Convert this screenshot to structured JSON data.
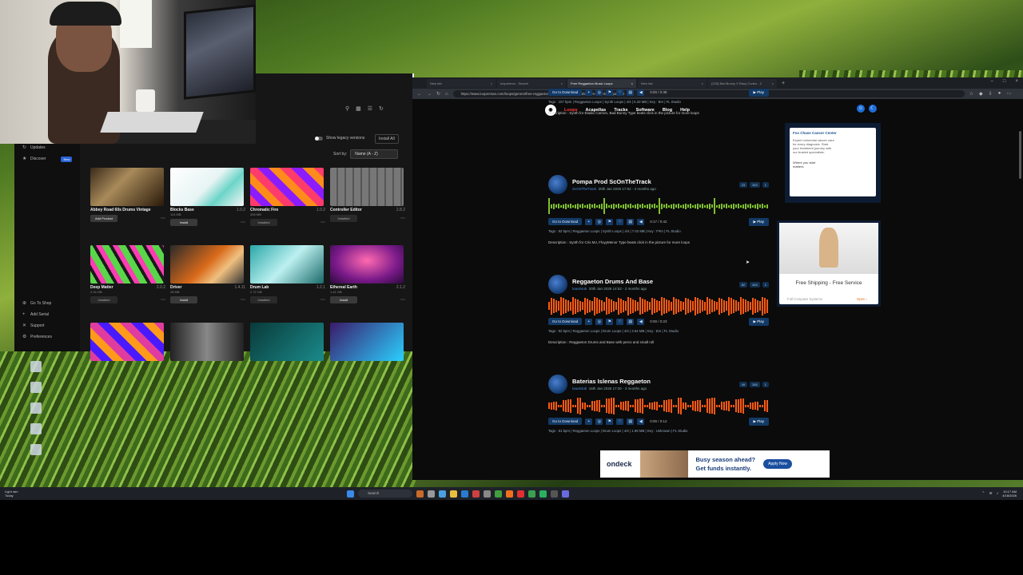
{
  "app": {
    "sidebar": {
      "items": [
        {
          "label": "Updates",
          "icon": "refresh-icon"
        },
        {
          "label": "Discover",
          "icon": "star-icon",
          "badge": "New"
        }
      ],
      "bottom_items": [
        {
          "label": "Go To Shop",
          "icon": "cart-icon"
        },
        {
          "label": "Add Serial",
          "icon": "plus-icon"
        },
        {
          "label": "Support",
          "icon": "support-icon"
        },
        {
          "label": "Preferences",
          "icon": "gear-icon"
        }
      ]
    },
    "legacy_toggle_label": "Show legacy versions",
    "install_all_label": "Install All",
    "sort_label": "Sort by:",
    "sort_value": "Name (A - Z)",
    "products": [
      {
        "name": "Abbey Road 60s Drums Vintage",
        "version": "",
        "size": "",
        "button": "Add Product",
        "thumb": "linear-gradient(135deg,#3a2a1a,#a88a5a 40%,#2a1a0a)"
      },
      {
        "name": "Blocks Base",
        "version": "1.0.2",
        "size": "114 MB",
        "button": "Install",
        "thumb": "linear-gradient(135deg,#ffffff,#e8f4f4 50%,#6cd4c8 70%,#f7f7f7)"
      },
      {
        "name": "Chromatic Fire",
        "version": "1.0.2",
        "size": "498 MB",
        "button": "Installed",
        "thumb": "repeating-linear-gradient(45deg,#ff3b6b 0 10px,#8a1cff 10px 20px,#ff8c1a 20px 30px)"
      },
      {
        "name": "Controller Editor",
        "version": "2.8.2",
        "size": "",
        "button": "Installed",
        "thumb": "repeating-linear-gradient(90deg,#777 0 8px,#555 8px 10px)"
      },
      {
        "name": "Deep Matter",
        "version": "2.0.2",
        "size": "2.04 GB",
        "button": "Installed",
        "thumb": "repeating-linear-gradient(60deg,#5ad64a 0 8px,#1a1a1a 8px 12px,#ff3cb4 12px 18px)"
      },
      {
        "name": "Driver",
        "version": "1.4.11",
        "size": "28 MB",
        "button": "Install",
        "thumb": "linear-gradient(135deg,#2a2a2a,#d96a1a 50%,#f0c080 70%,#333)"
      },
      {
        "name": "Drum Lab",
        "version": "1.2.1",
        "size": "2.72 GB",
        "button": "Installed",
        "thumb": "linear-gradient(135deg,#2aa8a8,#bdf0f0 50%,#1a6a6a)"
      },
      {
        "name": "Ethereal Earth",
        "version": "2.1.2",
        "size": "1.41 GB",
        "button": "Install",
        "thumb": "radial-gradient(ellipse at 50% 40%,#ff6ab0,#7a1a8a 60%,#2a0a3a)"
      },
      {
        "name": "",
        "version": "",
        "size": "",
        "button": "",
        "thumb": "repeating-linear-gradient(45deg,#e03ca0 0 10px,#4a1aff 10px 20px,#ff9a1a 20px 30px)"
      },
      {
        "name": "",
        "version": "",
        "size": "",
        "button": "",
        "thumb": "linear-gradient(90deg,#222,#888 50%,#222)"
      },
      {
        "name": "",
        "version": "",
        "size": "",
        "button": "",
        "thumb": "linear-gradient(135deg,#0a3a3a,#1a8a8a)"
      },
      {
        "name": "",
        "version": "",
        "size": "",
        "button": "",
        "thumb": "linear-gradient(135deg,#3a1a6a,#2ad0ff)"
      }
    ]
  },
  "browser": {
    "tabs": [
      {
        "label": "New tab"
      },
      {
        "label": "loopermon - Search"
      },
      {
        "label": "Free Reggaeton Music Loops",
        "active": true
      },
      {
        "label": "New tab"
      },
      {
        "label": "(225) Bad Bunny X Rauy Cortez - 2"
      }
    ],
    "url": "https://www.looperman.com/loops/genres/free-reggaeton-loops-samples-sounds-wavs-download?page=3",
    "site_nav": [
      "Loops",
      "Acapellas",
      "Tracks",
      "Software",
      "Blog",
      "Help"
    ],
    "loops": [
      {
        "title": "",
        "user": "",
        "date": "",
        "counts": [],
        "time": "0:00 / 0:38",
        "tags": "Tags : 107 bpm | Reggaeton Loops | Synth Loops | 4/4 | 6.33 MB | Key : Bm | FL Studio",
        "description": "Description : Synth for Eladio Carrion, Bad Bunny Type beats click in the picture for more loops",
        "wave": "none"
      },
      {
        "title": "Pompa Prod ScOnTheTrack",
        "user": "ScOnTheTrack",
        "date": "20th Jan 2026 17:52 - 2 months ago",
        "counts": [
          "23",
          "343",
          "1"
        ],
        "time": "0:17 / 0:42",
        "tags": "Tags : 92 bpm | Reggaeton Loops | Synth Loops | 4/4 | 7.02 MB | Key : F#m | FL Studio",
        "description": "Description : Synth for Cris MJ, FloyyMenor Type beats click in the picture for more loops",
        "wave": "green"
      },
      {
        "title": "Reggaeton Drums And Base",
        "user": "loao04ok",
        "date": "20th Jan 2026 14:52 - 2 months ago",
        "counts": [
          "82",
          "444",
          "1"
        ],
        "time": "0:00 / 0:23",
        "tags": "Tags : 92 bpm | Reggaeton Loops | Drum Loops | 4/4 | 3.94 MB | Key : Em | FL Studio",
        "description": "Description : Reggaeton Drums and Base with percs and small roll",
        "wave": "orange"
      },
      {
        "title": "Baterias Islenas Reggaeton",
        "user": "loao04ok",
        "date": "16th Jan 2026 17:30 - 3 months ago",
        "counts": [
          "49",
          "265",
          "1"
        ],
        "time": "0:00 / 0:12",
        "tags": "Tags : 81 bpm | Reggaeton Loops | Drum Loops | 4/4 | 1.99 MB | Key : Unknown | FL Studio",
        "description": "",
        "wave": "orange"
      }
    ],
    "download_label": "Go to Download",
    "play_label": "▶ Play",
    "ads": {
      "fox": {
        "title": "Fox Chase Cancer Center",
        "body": "Expert colorectal cancer care for every diagnosis. Start your treatment journey with our trusted specialists.",
        "tagline": "Where you start matters."
      },
      "ship": {
        "title": "Free Shipping - Free Service",
        "sponsor": "Full Compass Systems",
        "cta": "Open ›"
      },
      "ondeck": {
        "brand": "ondeck",
        "line1": "Busy season ahead?",
        "line2": "Get funds instantly.",
        "cta": "Apply Now"
      }
    }
  },
  "taskbar": {
    "weather": "Light rain",
    "weather2": "Today",
    "search": "Search",
    "time": "10:17 AM",
    "date": "4/18/2026"
  }
}
